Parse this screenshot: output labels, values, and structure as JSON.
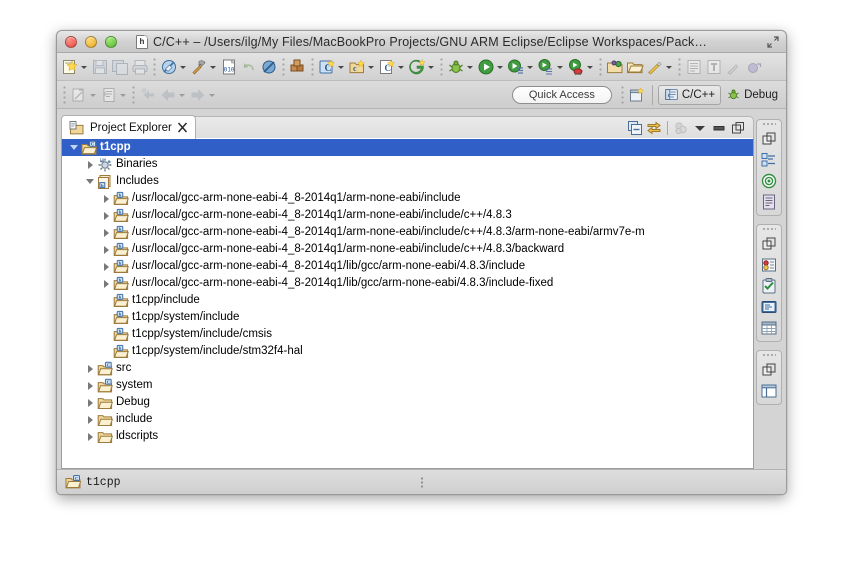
{
  "window": {
    "title": "C/C++ – /Users/ilg/My Files/MacBookPro Projects/GNU ARM Eclipse/Eclipse Workspaces/Pack…",
    "app_icon": "h",
    "accent_selection": "#2f5fc7",
    "chrome_bg": "#dcdcdc"
  },
  "titlebar_buttons": {
    "close": "close-button",
    "minimize": "minimize-button",
    "zoom": "zoom-button",
    "fullscreen": "fullscreen-button"
  },
  "toolbar": {
    "row1": [
      {
        "name": "new-wizard",
        "icon": "new-file",
        "dropdown": true,
        "enabled": true
      },
      {
        "name": "save",
        "icon": "save-floppy",
        "dropdown": false,
        "enabled": false
      },
      {
        "name": "save-all",
        "icon": "save-all",
        "dropdown": false,
        "enabled": false
      },
      {
        "name": "print",
        "icon": "printer",
        "dropdown": false,
        "enabled": false
      },
      {
        "separator": true
      },
      {
        "name": "build-all",
        "icon": "build-hammer-disabled",
        "dropdown": true,
        "enabled": false
      },
      {
        "name": "build",
        "icon": "hammer",
        "dropdown": true,
        "enabled": true
      },
      {
        "name": "open-element",
        "icon": "binary-010",
        "dropdown": false,
        "enabled": true
      },
      {
        "name": "undo",
        "icon": "undo-arrow",
        "dropdown": false,
        "enabled": false
      },
      {
        "name": "skip-breakpoints",
        "icon": "skip-breakpoints",
        "dropdown": false,
        "enabled": true
      },
      {
        "separator": true
      },
      {
        "name": "build-configurations",
        "icon": "blocks",
        "dropdown": false,
        "enabled": true
      },
      {
        "separator": true
      },
      {
        "name": "new-c-project",
        "icon": "c-new-blue",
        "dropdown": true,
        "enabled": true
      },
      {
        "name": "new-cpp-project",
        "icon": "cpp-new-folder",
        "dropdown": true,
        "enabled": true
      },
      {
        "name": "new-class",
        "icon": "c-class",
        "dropdown": true,
        "enabled": true
      },
      {
        "name": "new-git",
        "icon": "git-green",
        "dropdown": true,
        "enabled": true
      },
      {
        "separator": true
      },
      {
        "name": "debug",
        "icon": "debug-bug",
        "dropdown": true,
        "enabled": true
      },
      {
        "name": "run",
        "icon": "run-green",
        "dropdown": true,
        "enabled": true
      },
      {
        "name": "run-external-tools",
        "icon": "run-external",
        "dropdown": true,
        "enabled": true
      },
      {
        "name": "run-last",
        "icon": "run-list",
        "dropdown": true,
        "enabled": true
      },
      {
        "name": "profile",
        "icon": "profile-run",
        "dropdown": true,
        "enabled": true
      },
      {
        "separator": true
      },
      {
        "name": "open-type",
        "icon": "open-folder-green",
        "dropdown": false,
        "enabled": true
      },
      {
        "name": "open-resource",
        "icon": "open-folder",
        "dropdown": false,
        "enabled": true
      },
      {
        "name": "search",
        "icon": "pencil-yellow",
        "dropdown": true,
        "enabled": true
      },
      {
        "separator": true
      },
      {
        "name": "toggle-mark-occurrences",
        "icon": "list-lines",
        "dropdown": false,
        "enabled": false
      },
      {
        "name": "toggle-block-selection",
        "icon": "pilcrow",
        "dropdown": false,
        "enabled": false
      },
      {
        "name": "annotation",
        "icon": "pen-tool",
        "dropdown": false,
        "enabled": false
      },
      {
        "name": "next-annotation",
        "icon": "globe-arrow",
        "dropdown": false,
        "enabled": false
      }
    ],
    "row2": [
      {
        "name": "open-declaration",
        "icon": "open-decl",
        "dropdown": true,
        "enabled": false
      },
      {
        "name": "open-call-hierarchy",
        "icon": "call-hierarchy",
        "dropdown": true,
        "enabled": false
      },
      {
        "name": "back-to",
        "icon": "back-small",
        "dropdown": false,
        "enabled": false
      },
      {
        "name": "navigate-back",
        "icon": "arrow-left",
        "dropdown": true,
        "enabled": false
      },
      {
        "name": "navigate-forward",
        "icon": "arrow-right",
        "dropdown": true,
        "enabled": false
      }
    ],
    "quick_access_placeholder": "Quick Access",
    "new-perspective": "open-perspective-button",
    "perspectives": [
      {
        "label": "C/C++",
        "icon": "cpp-perspective-icon",
        "active": true
      },
      {
        "label": "Debug",
        "icon": "debug-perspective-icon",
        "active": false
      }
    ]
  },
  "view": {
    "tab_label": "Project Explorer",
    "tab_icon": "project-explorer-icon",
    "close_icon": "✖",
    "toolbar": [
      {
        "name": "collapse-all-button",
        "icon": "collapse-all-icon",
        "enabled": true
      },
      {
        "name": "link-with-editor-button",
        "icon": "link-editor-icon",
        "enabled": true
      },
      {
        "name": "focus-on-active-task-button",
        "icon": "focus-task-icon",
        "enabled": false
      },
      {
        "name": "view-menu-button",
        "icon": "chevron-down-icon",
        "enabled": true
      },
      {
        "name": "minimize-view-button",
        "icon": "minimize-icon",
        "enabled": true
      },
      {
        "name": "maximize-view-button",
        "icon": "maximize-icon",
        "enabled": true
      }
    ]
  },
  "tree": [
    {
      "label": "t1cpp",
      "indent": 0,
      "twisty": "open",
      "icon": "c-project",
      "selected": true
    },
    {
      "label": "Binaries",
      "indent": 1,
      "twisty": "closed",
      "icon": "binaries",
      "selected": false
    },
    {
      "label": "Includes",
      "indent": 1,
      "twisty": "open",
      "icon": "includes",
      "selected": false
    },
    {
      "label": "/usr/local/gcc-arm-none-eabi-4_8-2014q1/arm-none-eabi/include",
      "indent": 2,
      "twisty": "closed",
      "icon": "include-folder",
      "selected": false
    },
    {
      "label": "/usr/local/gcc-arm-none-eabi-4_8-2014q1/arm-none-eabi/include/c++/4.8.3",
      "indent": 2,
      "twisty": "closed",
      "icon": "include-folder",
      "selected": false
    },
    {
      "label": "/usr/local/gcc-arm-none-eabi-4_8-2014q1/arm-none-eabi/include/c++/4.8.3/arm-none-eabi/armv7e-m",
      "indent": 2,
      "twisty": "closed",
      "icon": "include-folder",
      "selected": false
    },
    {
      "label": "/usr/local/gcc-arm-none-eabi-4_8-2014q1/arm-none-eabi/include/c++/4.8.3/backward",
      "indent": 2,
      "twisty": "closed",
      "icon": "include-folder",
      "selected": false
    },
    {
      "label": "/usr/local/gcc-arm-none-eabi-4_8-2014q1/lib/gcc/arm-none-eabi/4.8.3/include",
      "indent": 2,
      "twisty": "closed",
      "icon": "include-folder",
      "selected": false
    },
    {
      "label": "/usr/local/gcc-arm-none-eabi-4_8-2014q1/lib/gcc/arm-none-eabi/4.8.3/include-fixed",
      "indent": 2,
      "twisty": "closed",
      "icon": "include-folder",
      "selected": false
    },
    {
      "label": "t1cpp/include",
      "indent": 2,
      "twisty": "none",
      "icon": "include-folder",
      "selected": false
    },
    {
      "label": "t1cpp/system/include",
      "indent": 2,
      "twisty": "none",
      "icon": "include-folder",
      "selected": false
    },
    {
      "label": "t1cpp/system/include/cmsis",
      "indent": 2,
      "twisty": "none",
      "icon": "include-folder",
      "selected": false
    },
    {
      "label": "t1cpp/system/include/stm32f4-hal",
      "indent": 2,
      "twisty": "none",
      "icon": "include-folder",
      "selected": false
    },
    {
      "label": "src",
      "indent": 1,
      "twisty": "closed",
      "icon": "source-folder",
      "selected": false
    },
    {
      "label": "system",
      "indent": 1,
      "twisty": "closed",
      "icon": "source-folder",
      "selected": false
    },
    {
      "label": "Debug",
      "indent": 1,
      "twisty": "closed",
      "icon": "folder",
      "selected": false
    },
    {
      "label": "include",
      "indent": 1,
      "twisty": "closed",
      "icon": "folder",
      "selected": false
    },
    {
      "label": "ldscripts",
      "indent": 1,
      "twisty": "closed",
      "icon": "folder",
      "selected": false
    }
  ],
  "statusbar": {
    "selection_label": "t1cpp",
    "icon": "c-project-icon"
  },
  "fastview": {
    "groups": [
      {
        "items": [
          {
            "name": "restore-icon",
            "icon": "restore"
          },
          {
            "name": "outline-view-icon",
            "icon": "outline"
          },
          {
            "name": "target-view-icon",
            "icon": "target"
          },
          {
            "name": "document-view-icon",
            "icon": "document"
          }
        ]
      },
      {
        "items": [
          {
            "name": "restore-icon",
            "icon": "restore"
          },
          {
            "name": "problems-view-icon",
            "icon": "problems"
          },
          {
            "name": "tasks-view-icon",
            "icon": "tasks"
          },
          {
            "name": "console-view-icon",
            "icon": "console"
          },
          {
            "name": "properties-view-icon",
            "icon": "properties"
          }
        ]
      },
      {
        "items": [
          {
            "name": "restore-icon",
            "icon": "restore"
          },
          {
            "name": "layout-view-icon",
            "icon": "layout"
          }
        ]
      }
    ]
  }
}
